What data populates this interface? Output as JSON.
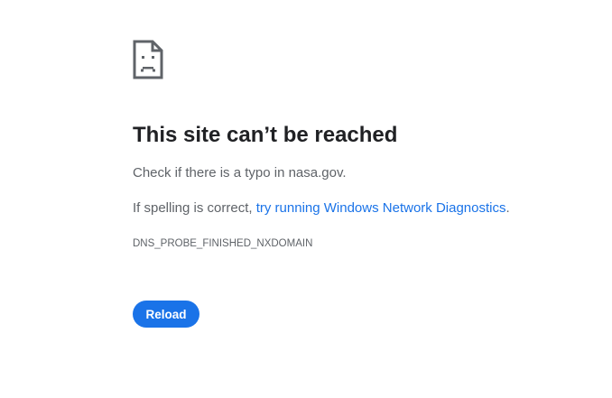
{
  "error": {
    "icon": "sad-page-icon",
    "title": "This site can’t be reached",
    "typo_message": "Check if there is a typo in nasa.gov.",
    "spelling_prefix": "If spelling is correct, ",
    "diagnostics_link": "try running Windows Network Diagnostics",
    "spelling_suffix": ".",
    "code": "DNS_PROBE_FINISHED_NXDOMAIN"
  },
  "actions": {
    "reload_label": "Reload"
  },
  "colors": {
    "accent": "#1a73e8",
    "text_primary": "#202124",
    "text_secondary": "#5f6368",
    "background": "#ffffff"
  }
}
